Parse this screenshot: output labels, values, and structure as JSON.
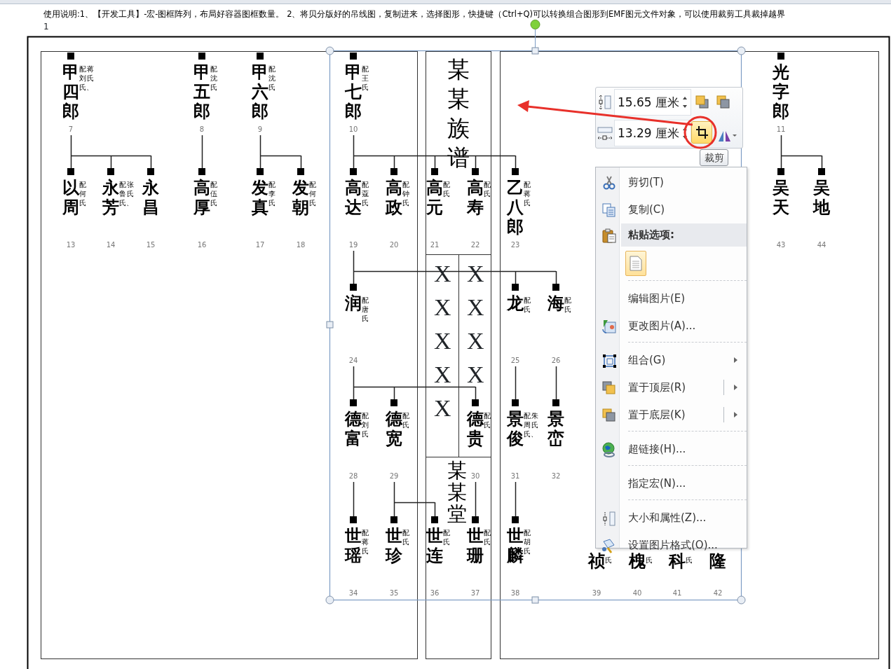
{
  "instructions": "使用说明:1、【开发工具】-宏-图框阵列，布局好容器图框数量。 2、将贝分版好的吊线图，复制进来，选择图形，快捷键（Ctrl+Q)可以转换组合图形到EMF图元文件对象，可以使用裁剪工具裁掉越界",
  "page_number": "1",
  "document": {
    "title": "某某族谱",
    "hall_name": "某某堂",
    "placeholder_marks": {
      "left": [
        "X",
        "X",
        "X",
        "X",
        "X"
      ],
      "right": [
        "X",
        "X",
        "X",
        "X"
      ]
    },
    "family_tree": [
      {
        "name": "甲四郎",
        "spouse": [
          "配刘氏、",
          "蒋氏"
        ],
        "number": "7",
        "children": [
          {
            "name": "以周",
            "spouse": [
              "配何氏"
            ],
            "number": "13"
          },
          {
            "name": "永芳",
            "spouse": [
              "配鲁氏、",
              "张氏"
            ],
            "number": "14"
          },
          {
            "name": "永昌",
            "number": "15"
          }
        ]
      },
      {
        "name": "甲五郎",
        "spouse": [
          "配沈氏"
        ],
        "number": "8",
        "children": [
          {
            "name": "高厚",
            "spouse": [
              "配伍氏"
            ],
            "number": "16"
          }
        ]
      },
      {
        "name": "甲六郎",
        "spouse": [
          "配沈氏"
        ],
        "number": "9",
        "children": [
          {
            "name": "发真",
            "spouse": [
              "配李氏"
            ],
            "number": "17"
          },
          {
            "name": "发朝",
            "spouse": [
              "配何氏"
            ],
            "number": "18"
          }
        ]
      },
      {
        "name": "甲七郎",
        "spouse": [
          "配王氏"
        ],
        "number": "10",
        "children": [
          {
            "name": "高达",
            "spouse": [
              "配蔻氏"
            ],
            "number": "19",
            "children": [
              {
                "name": "润",
                "spouse": [
                  "配唐氏"
                ],
                "number": "24",
                "children": [
                  {
                    "name": "德富",
                    "spouse": [
                      "配刘氏"
                    ],
                    "number": "28",
                    "children": [
                      {
                        "name": "世瑶",
                        "spouse": [
                          "配蒋氏"
                        ],
                        "number": "34"
                      }
                    ]
                  },
                  {
                    "name": "德宽",
                    "spouse": [
                      "配氏"
                    ],
                    "number": "29",
                    "children": [
                      {
                        "name": "世珍",
                        "spouse": [
                          "配氏"
                        ],
                        "number": "35"
                      },
                      {
                        "name": "世连",
                        "spouse": [
                          "配氏"
                        ],
                        "number": "36"
                      }
                    ]
                  },
                  {
                    "name": "德贵",
                    "spouse": [
                      "配氏"
                    ],
                    "number": "30",
                    "children": [
                      {
                        "name": "世珊",
                        "spouse": [
                          "配氏"
                        ],
                        "number": "37"
                      }
                    ]
                  }
                ]
              },
              {
                "name": "龙",
                "spouse": [
                  "配氏"
                ],
                "number": "25",
                "children": [
                  {
                    "name": "景俊",
                    "spouse": [
                      "配周氏、",
                      "朱氏"
                    ],
                    "number": "31",
                    "children": [
                      {
                        "name": "世麟",
                        "spouse": [
                          "配胡氏"
                        ],
                        "number": "38"
                      }
                    ]
                  }
                ]
              },
              {
                "name": "海",
                "spouse": [
                  "配氏"
                ],
                "number": "26",
                "children": [
                  {
                    "name": "景峦",
                    "number": "32"
                  }
                ]
              }
            ]
          },
          {
            "name": "高政",
            "spouse": [
              "配钟氏"
            ],
            "number": "20"
          },
          {
            "name": "高元",
            "spouse": [
              "配氏"
            ],
            "number": "21"
          },
          {
            "name": "高寿",
            "spouse": [
              "配氏"
            ],
            "number": "22"
          },
          {
            "name": "乙八郎",
            "spouse": [
              "配蒋氏"
            ],
            "number": "23"
          }
        ]
      },
      {
        "name": "光字郎",
        "number": "11",
        "children": [
          {
            "name": "吴天",
            "number": "43"
          },
          {
            "name": "吴地",
            "number": "44"
          }
        ]
      }
    ],
    "partly_covered_nodes": [
      {
        "name": "祯",
        "spouse": [
          "氏"
        ],
        "number": "39"
      },
      {
        "name": "槐",
        "spouse": [
          "氏"
        ],
        "number": "40"
      },
      {
        "name": "科",
        "spouse": [
          "氏"
        ],
        "number": "41"
      },
      {
        "name": "隆",
        "number": "42"
      }
    ]
  },
  "mini_toolbar": {
    "height": "15.65 厘米",
    "width": "13.29 厘米",
    "crop_button": {
      "selected": true
    },
    "tooltip": "裁剪"
  },
  "context_menu": [
    {
      "kind": "item",
      "label": "剪切(T)",
      "selected": false
    },
    {
      "kind": "item",
      "label": "复制(C)",
      "selected": false
    },
    {
      "kind": "header",
      "label": "粘贴选项:",
      "selected": true
    },
    {
      "kind": "paste_options"
    },
    {
      "kind": "separator"
    },
    {
      "kind": "item",
      "label": "编辑图片(E)",
      "selected": false
    },
    {
      "kind": "item",
      "label": "更改图片(A)...",
      "selected": false
    },
    {
      "kind": "separator"
    },
    {
      "kind": "submenu",
      "label": "组合(G)",
      "selected": false
    },
    {
      "kind": "split",
      "label": "置于顶层(R)",
      "selected": false
    },
    {
      "kind": "split",
      "label": "置于底层(K)",
      "selected": false
    },
    {
      "kind": "separator"
    },
    {
      "kind": "item",
      "label": "超链接(H)...",
      "selected": false
    },
    {
      "kind": "separator"
    },
    {
      "kind": "item",
      "label": "指定宏(N)...",
      "selected": false
    },
    {
      "kind": "separator"
    },
    {
      "kind": "item",
      "label": "大小和属性(Z)...",
      "selected": false
    },
    {
      "kind": "item",
      "label": "设置图片格式(O)...",
      "selected": false
    }
  ]
}
